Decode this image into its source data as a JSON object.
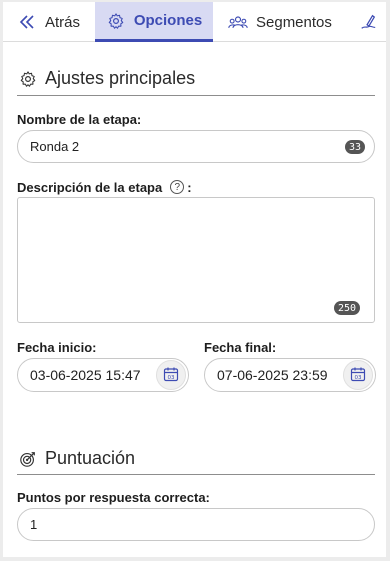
{
  "tabs": [
    {
      "label": "Atrás",
      "icon": "chevron-double-left-icon"
    },
    {
      "label": "Opciones",
      "icon": "gear-icon"
    },
    {
      "label": "Segmentos",
      "icon": "users-group-icon"
    },
    {
      "label": "",
      "icon": "pen-signature-icon"
    }
  ],
  "main_settings": {
    "title": "Ajustes principales",
    "stage_name_label": "Nombre de la etapa:",
    "stage_name_value": "Ronda 2",
    "stage_name_counter": "33",
    "description_label": "Descripción de la etapa",
    "description_help": "?",
    "description_suffix": ":",
    "description_value": "",
    "description_counter": "250",
    "start_label": "Fecha inicio:",
    "start_value": "03-06-2025 15:47",
    "end_label": "Fecha final:",
    "end_value": "07-06-2025 23:59"
  },
  "scoring": {
    "title": "Puntuación",
    "points_label": "Puntos por respuesta correcta:",
    "points_value": "1"
  },
  "colors": {
    "accent": "#3d4bb3",
    "active_tab_bg": "#d8daf3",
    "counter_bg": "#555555"
  }
}
